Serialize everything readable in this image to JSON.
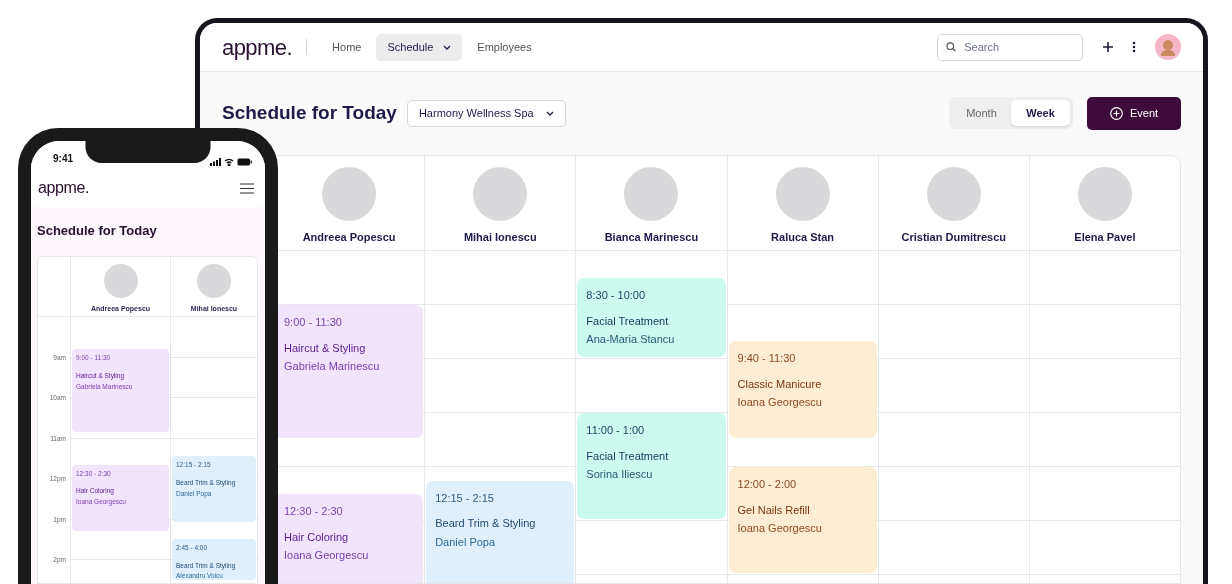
{
  "desktop": {
    "logo": "appme.",
    "nav": [
      {
        "label": "Home",
        "selected": false,
        "dropdown": false
      },
      {
        "label": "Schedule",
        "selected": true,
        "dropdown": true
      },
      {
        "label": "Employees",
        "selected": false,
        "dropdown": false
      }
    ],
    "search": {
      "placeholder": "Search"
    },
    "title": "Schedule for Today",
    "location_select": "Harmony Wellness Spa",
    "view_toggle": [
      {
        "label": "Month",
        "selected": false
      },
      {
        "label": "Week",
        "selected": true
      }
    ],
    "event_button": "Event",
    "staff": [
      {
        "name": "Andreea Popescu",
        "events": [
          {
            "time": "9:00 - 11:30",
            "service": "Haircut & Styling",
            "client": "Gabriela Marinescu",
            "color": "#f1e4fd"
          },
          {
            "time": "12:30 - 2:30",
            "service": "Hair Coloring",
            "client": "Ioana Georgescu",
            "color": "#f1e4fd"
          }
        ]
      },
      {
        "name": "Mihai Ionescu",
        "events": [
          {
            "time": "12:15 - 2:15",
            "service": "Beard Trim & Styling",
            "client": "Daniel Popa",
            "color": "#dff0fc"
          }
        ]
      },
      {
        "name": "Bianca Marinescu",
        "events": [
          {
            "time": "8:30 - 10:00",
            "service": "Facial Treatment",
            "client": "Ana-Maria Stancu",
            "color": "#ccfaee"
          },
          {
            "time": "11:00 - 1:00",
            "service": "Facial Treatment",
            "client": "Sorina Iliescu",
            "color": "#ccfaee"
          }
        ]
      },
      {
        "name": "Raluca Stan",
        "events": [
          {
            "time": "9:40 - 11:30",
            "service": "Classic Manicure",
            "client": "Ioana Georgescu",
            "color": "#ffecd4"
          },
          {
            "time": "12:00 - 2:00",
            "service": "Gel Nails Refill",
            "client": "Ioana Georgescu",
            "color": "#ffecd4"
          }
        ]
      },
      {
        "name": "Cristian Dumitrescu"
      },
      {
        "name": "Elena Pavel"
      }
    ]
  },
  "phone": {
    "time": "9:41",
    "logo": "appme.",
    "title": "Schedule for Today",
    "hours": [
      "9am",
      "10am",
      "11am",
      "12pm",
      "1pm",
      "2pm"
    ],
    "staff": [
      {
        "name": "Andreea Popescu",
        "events": [
          {
            "time": "9:00 - 11:30",
            "service": "Haircut & Styling",
            "client": "Gabriela Marinescu",
            "color": "#f1e4fd"
          },
          {
            "time": "12:30 - 2:30",
            "service": "Hair Coloring",
            "client": "Ioana Georgescu",
            "color": "#f1e4fd"
          }
        ]
      },
      {
        "name": "Mihai Ionescu",
        "events": [
          {
            "time": "12:15 - 2:15",
            "service": "Beard Trim & Styling",
            "client": "Daniel Popa",
            "color": "#dff0fc"
          },
          {
            "time": "2:45 - 4:00",
            "service": "Beard Trim & Styling",
            "client": "Alexandru Voicu",
            "color": "#dff0fc"
          }
        ]
      }
    ]
  }
}
